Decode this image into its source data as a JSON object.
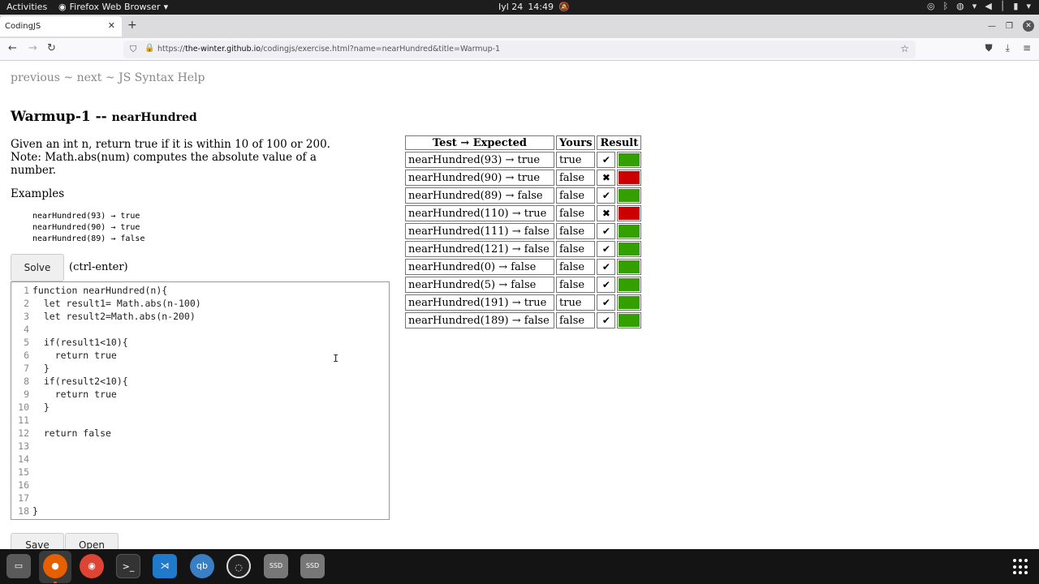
{
  "topbar": {
    "activities": "Activities",
    "app_name": "Firefox Web Browser",
    "date": "Iyl 24",
    "time": "14:49"
  },
  "browser": {
    "tab_title": "CodingJS",
    "url_prefix": "https://",
    "url_host": "the-winter.github.io",
    "url_path": "/codingjs/exercise.html?name=nearHundred&title=Warmup-1"
  },
  "page": {
    "nav": {
      "previous": "previous",
      "sep1": " ~ ",
      "next": "next",
      "sep2": " ~ ",
      "syntax": "JS Syntax Help"
    },
    "title_main": "Warmup-1 -- ",
    "title_fn": "nearHundred",
    "description": "Given an int n, return true if it is within 10 of 100 or 200. Note: Math.abs(num) computes the absolute value of a number.",
    "examples_label": "Examples",
    "examples": [
      "nearHundred(93) → true",
      "nearHundred(90) → true",
      "nearHundred(89) → false"
    ],
    "solve_label": "Solve",
    "solve_hint": "(ctrl-enter)",
    "save_label": "Save",
    "open_label": "Open"
  },
  "editor": {
    "lines": [
      "function nearHundred(n){",
      "  let result1= Math.abs(n-100)",
      "  let result2=Math.abs(n-200)",
      "",
      "  if(result1<10){",
      "    return true",
      "  }",
      "  if(result2<10){",
      "    return true",
      "  }",
      "",
      "  return false",
      "",
      "",
      "",
      "",
      "",
      "}"
    ]
  },
  "results": {
    "headers": [
      "Test → Expected",
      "Yours",
      "Result"
    ],
    "rows": [
      {
        "call": "nearHundred(93) → true",
        "yours": "true",
        "mark": "✔",
        "pass": true
      },
      {
        "call": "nearHundred(90) → true",
        "yours": "false",
        "mark": "✖",
        "pass": false
      },
      {
        "call": "nearHundred(89) → false",
        "yours": "false",
        "mark": "✔",
        "pass": true
      },
      {
        "call": "nearHundred(110) → true",
        "yours": "false",
        "mark": "✖",
        "pass": false
      },
      {
        "call": "nearHundred(111) → false",
        "yours": "false",
        "mark": "✔",
        "pass": true
      },
      {
        "call": "nearHundred(121) → false",
        "yours": "false",
        "mark": "✔",
        "pass": true
      },
      {
        "call": "nearHundred(0) → false",
        "yours": "false",
        "mark": "✔",
        "pass": true
      },
      {
        "call": "nearHundred(5) → false",
        "yours": "false",
        "mark": "✔",
        "pass": true
      },
      {
        "call": "nearHundred(191) → true",
        "yours": "true",
        "mark": "✔",
        "pass": true
      },
      {
        "call": "nearHundred(189) → false",
        "yours": "false",
        "mark": "✔",
        "pass": true
      }
    ],
    "pass_color": "#33a000",
    "fail_color": "#cc0000"
  },
  "dock": {
    "items": [
      "files-icon",
      "firefox-icon",
      "chrome-icon",
      "terminal-icon",
      "vscode-icon",
      "qbittorrent-icon",
      "obs-icon",
      "ssd-drive-icon",
      "ssd-drive-icon"
    ],
    "drive_label": "SSD",
    "qb_label": "qb"
  }
}
